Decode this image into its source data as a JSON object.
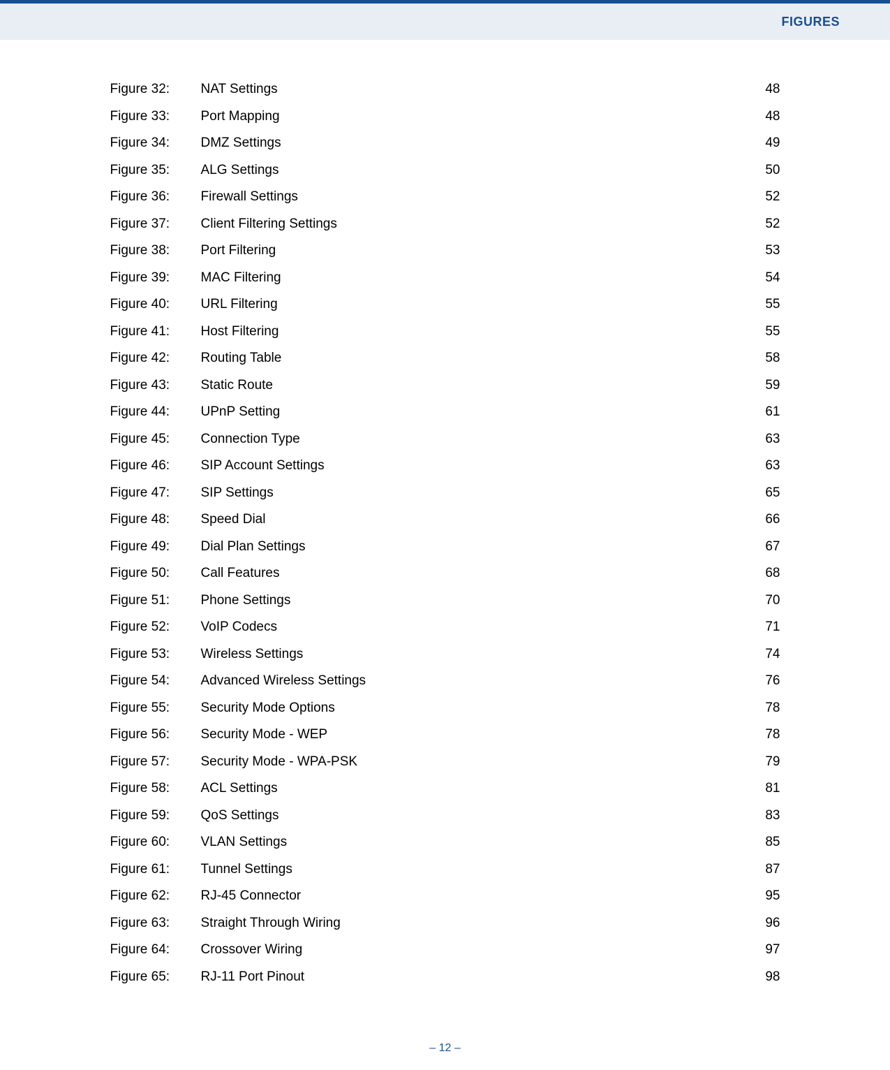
{
  "header": {
    "title": "FIGURES"
  },
  "figures": [
    {
      "label": "Figure 32:",
      "title": "NAT Settings",
      "page": "48"
    },
    {
      "label": "Figure 33:",
      "title": "Port Mapping",
      "page": "48"
    },
    {
      "label": "Figure 34:",
      "title": "DMZ Settings",
      "page": "49"
    },
    {
      "label": "Figure 35:",
      "title": "ALG Settings",
      "page": "50"
    },
    {
      "label": "Figure 36:",
      "title": "Firewall Settings",
      "page": "52"
    },
    {
      "label": "Figure 37:",
      "title": "Client Filtering Settings",
      "page": "52"
    },
    {
      "label": "Figure 38:",
      "title": "Port Filtering",
      "page": "53"
    },
    {
      "label": "Figure 39:",
      "title": "MAC Filtering",
      "page": "54"
    },
    {
      "label": "Figure 40:",
      "title": "URL Filtering",
      "page": "55"
    },
    {
      "label": "Figure 41:",
      "title": "Host Filtering",
      "page": "55"
    },
    {
      "label": "Figure 42:",
      "title": "Routing Table",
      "page": "58"
    },
    {
      "label": "Figure 43:",
      "title": "Static Route",
      "page": "59"
    },
    {
      "label": "Figure 44:",
      "title": "UPnP Setting",
      "page": "61"
    },
    {
      "label": "Figure 45:",
      "title": "Connection Type",
      "page": "63"
    },
    {
      "label": "Figure 46:",
      "title": "SIP Account Settings",
      "page": "63"
    },
    {
      "label": "Figure 47:",
      "title": "SIP Settings",
      "page": "65"
    },
    {
      "label": "Figure 48:",
      "title": "Speed Dial",
      "page": "66"
    },
    {
      "label": "Figure 49:",
      "title": "Dial Plan Settings",
      "page": "67"
    },
    {
      "label": "Figure 50:",
      "title": "Call Features",
      "page": "68"
    },
    {
      "label": "Figure 51:",
      "title": "Phone Settings",
      "page": "70"
    },
    {
      "label": "Figure 52:",
      "title": "VoIP Codecs",
      "page": "71"
    },
    {
      "label": "Figure 53:",
      "title": "Wireless Settings",
      "page": "74"
    },
    {
      "label": "Figure 54:",
      "title": "Advanced Wireless Settings",
      "page": "76"
    },
    {
      "label": "Figure 55:",
      "title": "Security Mode Options",
      "page": "78"
    },
    {
      "label": "Figure 56:",
      "title": "Security Mode - WEP",
      "page": "78"
    },
    {
      "label": "Figure 57:",
      "title": "Security Mode - WPA-PSK",
      "page": "79"
    },
    {
      "label": "Figure 58:",
      "title": "ACL Settings",
      "page": "81"
    },
    {
      "label": "Figure 59:",
      "title": "QoS Settings",
      "page": "83"
    },
    {
      "label": "Figure 60:",
      "title": "VLAN Settings",
      "page": "85"
    },
    {
      "label": "Figure 61:",
      "title": "Tunnel Settings",
      "page": "87"
    },
    {
      "label": "Figure 62:",
      "title": "RJ-45 Connector",
      "page": "95"
    },
    {
      "label": "Figure 63:",
      "title": "Straight Through Wiring",
      "page": "96"
    },
    {
      "label": "Figure 64:",
      "title": "Crossover Wiring",
      "page": "97"
    },
    {
      "label": "Figure 65:",
      "title": "RJ-11 Port Pinout",
      "page": "98"
    }
  ],
  "footer": {
    "page_number": "–  12  –"
  }
}
